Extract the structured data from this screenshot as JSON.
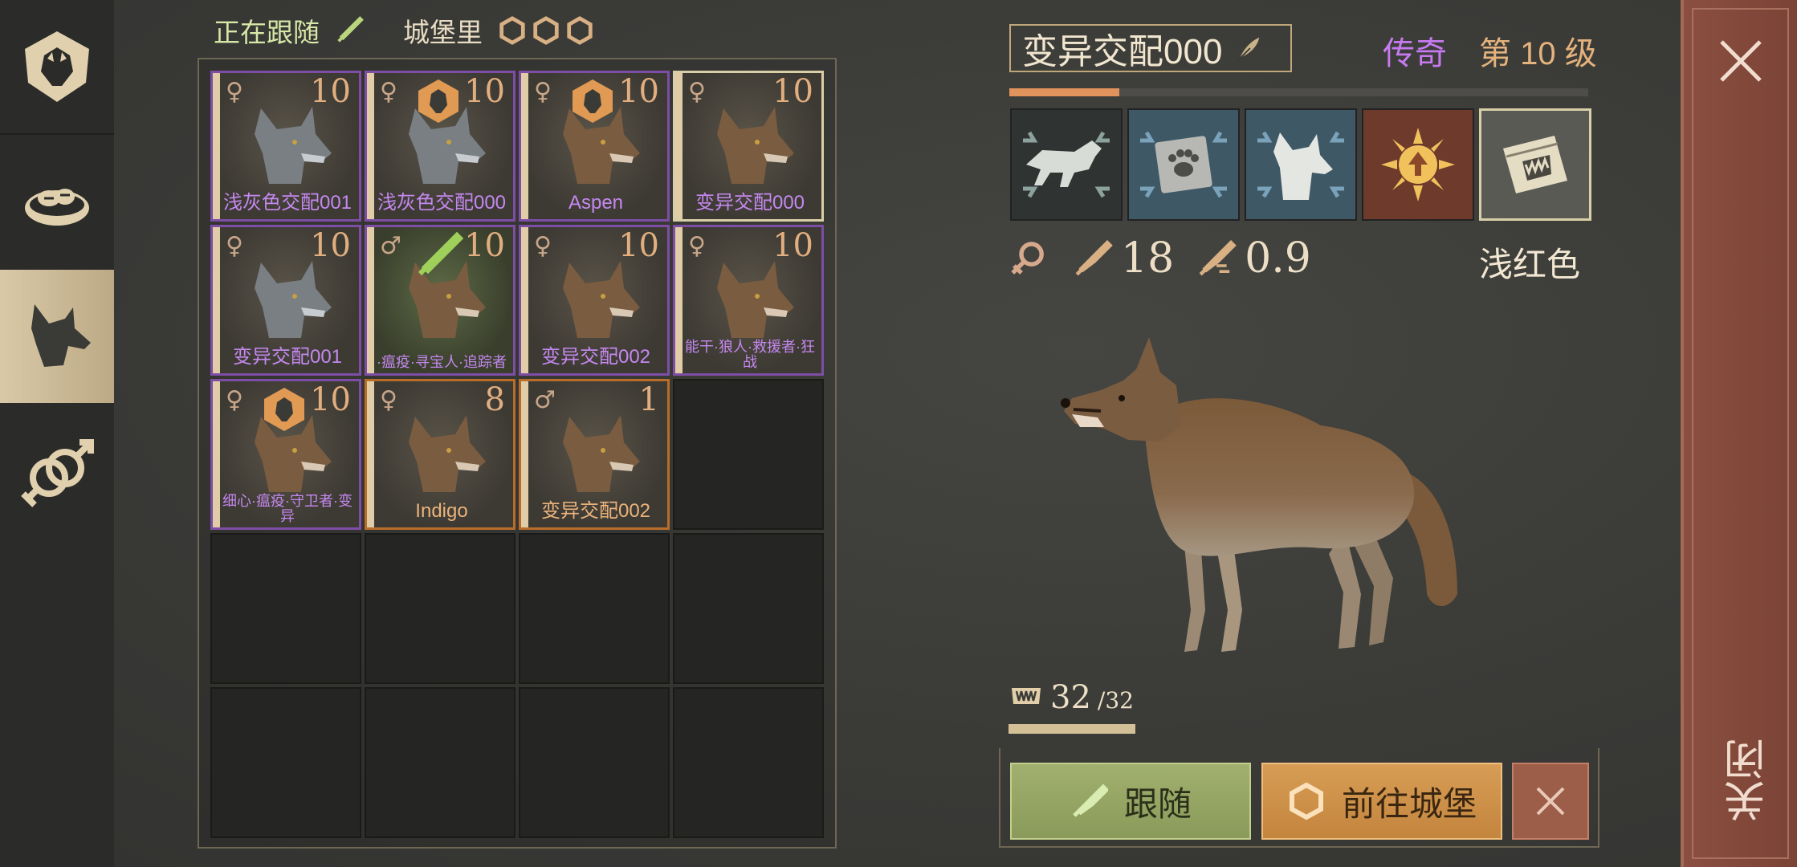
{
  "status": {
    "following_label": "正在跟随",
    "location_label": "城堡里"
  },
  "rail": {
    "tabs": [
      "pack-shield-icon",
      "food-bowl-icon",
      "wolf-head-icon",
      "breeding-gender-icon"
    ],
    "active_index": 2
  },
  "wolves": [
    {
      "name": "浅灰色交配001",
      "level": "10",
      "gender": "♀",
      "fur": "gray",
      "rarity": "purple",
      "badge": "none"
    },
    {
      "name": "浅灰色交配000",
      "level": "10",
      "gender": "♀",
      "fur": "gray",
      "rarity": "purple",
      "badge": "castle"
    },
    {
      "name": "Aspen",
      "level": "10",
      "gender": "♀",
      "fur": "brown",
      "rarity": "purple",
      "badge": "castle"
    },
    {
      "name": "变异交配000",
      "level": "10",
      "gender": "♀",
      "fur": "brown",
      "rarity": "purple",
      "badge": "none",
      "selected": true
    },
    {
      "name": "变异交配001",
      "level": "10",
      "gender": "♀",
      "fur": "gray",
      "rarity": "purple",
      "badge": "none"
    },
    {
      "name": "·瘟疫·寻宝人·追踪者",
      "level": "10",
      "gender": "♂",
      "fur": "brown",
      "rarity": "purple",
      "badge": "follow"
    },
    {
      "name": "变异交配002",
      "level": "10",
      "gender": "♀",
      "fur": "brown",
      "rarity": "purple",
      "badge": "none"
    },
    {
      "name": "能干·狼人·救援者·狂战",
      "level": "10",
      "gender": "♀",
      "fur": "brown",
      "rarity": "purple",
      "badge": "none"
    },
    {
      "name": "细心·瘟疫·守卫者·变异",
      "level": "10",
      "gender": "♀",
      "fur": "brown",
      "rarity": "purple",
      "badge": "castle"
    },
    {
      "name": "Indigo",
      "level": "8",
      "gender": "♀",
      "fur": "brown",
      "rarity": "orange",
      "badge": "none"
    },
    {
      "name": "变异交配002",
      "level": "1",
      "gender": "♂",
      "fur": "brown",
      "rarity": "orange",
      "badge": "none"
    }
  ],
  "detail": {
    "name": "变异交配000",
    "rarity_label": "传奇",
    "level_label": "第 10 级",
    "xp_fraction": 0.19,
    "skills": [
      "running-wolf-icon",
      "paw-tile-icon",
      "wolf-portrait-icon",
      "sun-arrow-icon",
      "fang-book-icon"
    ],
    "gender": "♀",
    "attack": "18",
    "speed": "0.9",
    "color_name": "浅红色",
    "bite_current": "32",
    "bite_max": "/32",
    "bite_fraction": 1.0
  },
  "buttons": {
    "follow": "跟随",
    "go_castle": "前往城堡"
  },
  "close_label": "关闭",
  "colors": {
    "purple_rarity": "#c77af0",
    "orange_rarity": "#ebb37a",
    "follow_green": "#a1b06e",
    "castle_orange": "#d79d55",
    "close_red": "#8b4f40"
  }
}
